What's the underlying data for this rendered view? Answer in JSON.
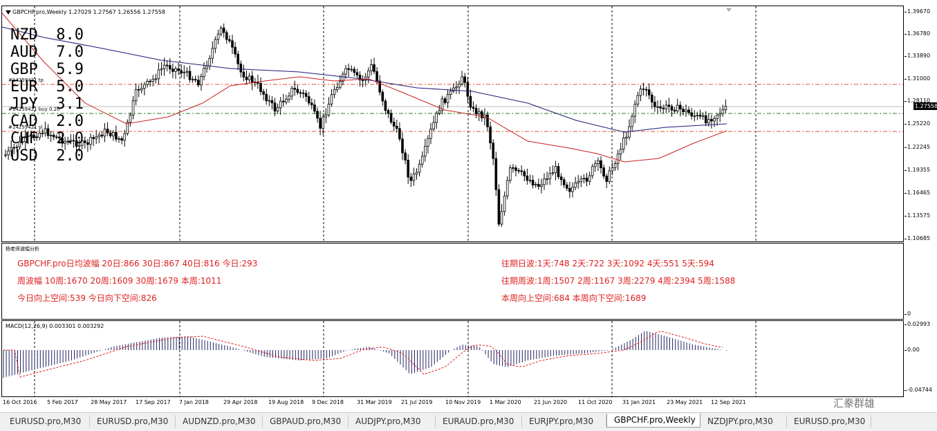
{
  "chart_window": {
    "symbol_header": "GBPCHF.pro,Weekly  1.27029 1.27567 1.26556 1.27558",
    "current_price": "1.27558",
    "price_scale": [
      "1.39670",
      "1.36780",
      "1.33890",
      "1.31000",
      "1.28110",
      "1.25220",
      "1.22245",
      "1.19355",
      "1.16465",
      "1.13575",
      "1.10685"
    ],
    "order_labels": [
      "#14259421 tp",
      "#14259421 buy 0.20",
      "#14259421 sl"
    ],
    "currency_strength": [
      {
        "ccy": "NZD",
        "val": "8.0"
      },
      {
        "ccy": "AUD",
        "val": "7.0"
      },
      {
        "ccy": "GBP",
        "val": "5.9"
      },
      {
        "ccy": "EUR",
        "val": "5.0"
      },
      {
        "ccy": "JPY",
        "val": "3.1"
      },
      {
        "ccy": "CAD",
        "val": "2.0"
      },
      {
        "ccy": "CHF",
        "val": "2.0"
      },
      {
        "ccy": "USD",
        "val": "2.0"
      }
    ],
    "date_axis": [
      "16 Oct 2016",
      "5 Feb 2017",
      "28 May 2017",
      "17 Sep 2017",
      "7 Jan 2018",
      "29 Apr 2018",
      "19 Aug 2018",
      "9 Dec 2018",
      "31 Mar 2019",
      "21 Jul 2019",
      "10 Nov 2019",
      "1 Mar 2020",
      "21 Jun 2020",
      "11 Oct 2020",
      "31 Jan 2021",
      "23 May 2021",
      "12 Sep 2021"
    ]
  },
  "indicator_window": {
    "title": "杨老师波幅分析",
    "scale_zero": "0",
    "lines_left": [
      "GBPCHF.pro日均波幅  20日:866  30日:867  40日:816 今日:293",
      "周波幅  10周:1670  20周:1609  30周:1679 本周:1011",
      "今日向上空间:539   今日向下空间:826"
    ],
    "lines_right": [
      "往期日波:1天:748 2天:722 3天:1092 4天:551 5天:594",
      "往期周波:1周:1507 2周:1167 3周:2279 4周:2394 5周:1588",
      "本周向上空间:684   本周向下空间:1689"
    ]
  },
  "macd_window": {
    "title": "MACD(12,26,9) 0.003301 0.003292",
    "scale": [
      "0.02993",
      "0.00",
      "-0.04744"
    ]
  },
  "tabs": [
    {
      "label": "EURUSD.pro,M30"
    },
    {
      "label": "EURUSD.pro,M30"
    },
    {
      "label": "AUDNZD.pro,M30"
    },
    {
      "label": "GBPAUD.pro,M30"
    },
    {
      "label": "AUDJPY.pro,M30"
    },
    {
      "label": "EURAUD.pro,M30"
    },
    {
      "label": "EURJPY.pro,M30"
    },
    {
      "label": "GBPCHF.pro,Weekly"
    },
    {
      "label": "NZDJPY.pro,M30"
    },
    {
      "label": "EURUSD.pro,M30"
    }
  ],
  "active_tab": "GBPCHF.pro,Weekly",
  "watermark": "汇豢群雄",
  "colors": {
    "candle": "#000000",
    "ma_blue": "#1a1a7a",
    "ma_red": "#cc2020",
    "tp_sl_line": "#e05020",
    "entry_line": "#208020",
    "indicator_text": "#e02020"
  }
}
